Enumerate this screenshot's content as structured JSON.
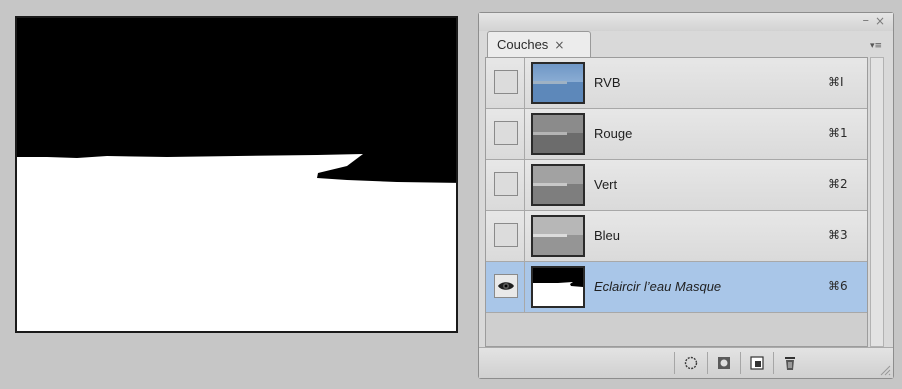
{
  "panel": {
    "tab_label": "Couches",
    "tab_close": "×",
    "minimize": "–",
    "close": "×",
    "menu": "▾≡"
  },
  "channels": [
    {
      "name": "RVB",
      "shortcut": "⌘I",
      "visible": false,
      "thumb": "color"
    },
    {
      "name": "Rouge",
      "shortcut": "⌘1",
      "visible": false,
      "thumb": "gray"
    },
    {
      "name": "Vert",
      "shortcut": "⌘2",
      "visible": false,
      "thumb": "gray"
    },
    {
      "name": "Bleu",
      "shortcut": "⌘3",
      "visible": false,
      "thumb": "gray"
    },
    {
      "name": "Eclaircir l’eau Masque",
      "shortcut": "⌘6",
      "visible": true,
      "selected": true,
      "thumb": "mask"
    }
  ],
  "footer_tools": [
    {
      "icon": "load-channel-as-selection-icon"
    },
    {
      "icon": "save-selection-as-channel-icon"
    },
    {
      "icon": "new-channel-icon"
    },
    {
      "icon": "delete-channel-icon"
    }
  ],
  "colors": {
    "selected_row": "#a9c6e8",
    "mask_black": "#000000",
    "mask_white": "#ffffff"
  }
}
